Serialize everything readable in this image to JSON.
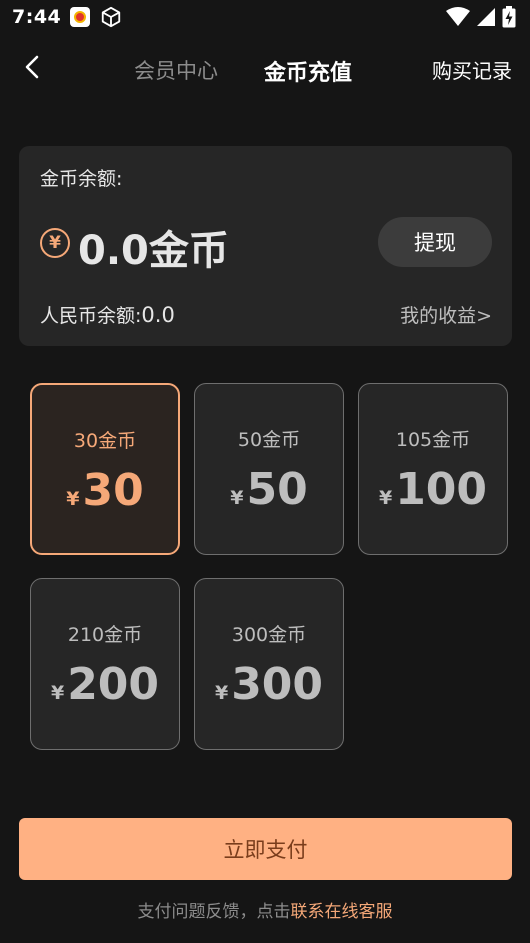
{
  "status_bar": {
    "time": "7:44",
    "icons": [
      "app-notification-icon",
      "cube-icon",
      "wifi-icon",
      "signal-icon",
      "battery-charging-icon"
    ]
  },
  "nav": {
    "tab_member": "会员中心",
    "tab_coin": "金币充值",
    "record": "购买记录"
  },
  "balance": {
    "label": "金币余额:",
    "coin_symbol": "¥",
    "amount": "0.0金币",
    "withdraw": "提现",
    "rmb_label": "人民币余额:",
    "rmb_value": "0.0",
    "earnings": "我的收益>"
  },
  "packages": [
    {
      "coins": "30金币",
      "yen": "¥",
      "price": "30",
      "selected": true
    },
    {
      "coins": "50金币",
      "yen": "¥",
      "price": "50",
      "selected": false
    },
    {
      "coins": "105金币",
      "yen": "¥",
      "price": "100",
      "selected": false
    },
    {
      "coins": "210金币",
      "yen": "¥",
      "price": "200",
      "selected": false
    },
    {
      "coins": "300金币",
      "yen": "¥",
      "price": "300",
      "selected": false
    }
  ],
  "pay": {
    "button": "立即支付",
    "feedback_prefix": "支付问题反馈，点击",
    "feedback_link": "联系在线客服"
  },
  "colors": {
    "accent": "#f5a878",
    "pay_button": "#ffb183",
    "background": "#151515",
    "card": "#262626"
  }
}
